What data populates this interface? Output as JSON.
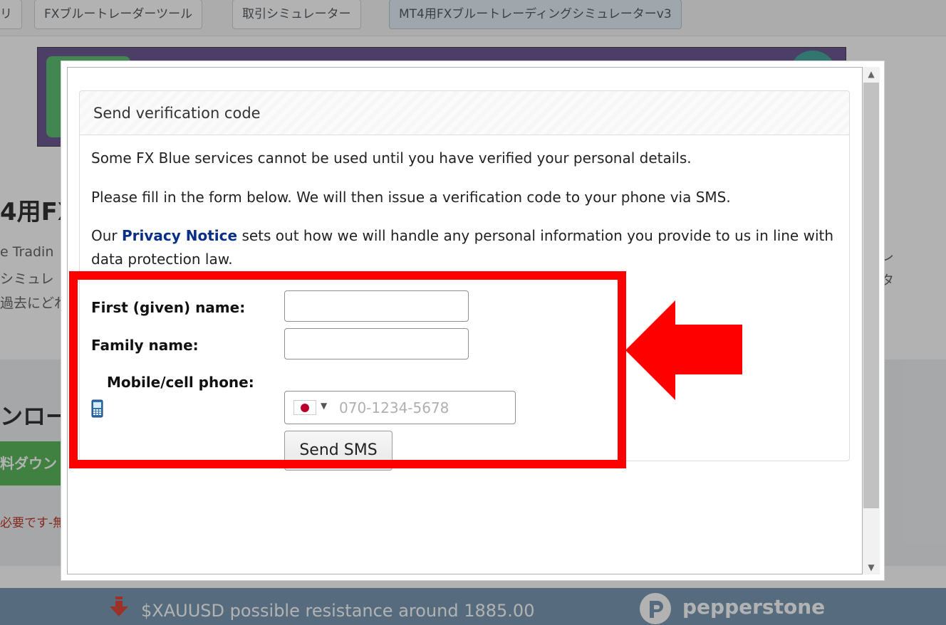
{
  "breadcrumbs": [
    {
      "label": "リ"
    },
    {
      "label": "FXブルートレーダーツール"
    },
    {
      "label": "取引シミュレーター"
    },
    {
      "label": "MT4用FXブルートレーディングシミュレーターv3"
    }
  ],
  "background": {
    "title_fragment": "4用FX",
    "lines": [
      "e Tradin",
      "シミュレ",
      "過去にどれ"
    ],
    "right_fragments": [
      "レ",
      "タ"
    ],
    "download_title_fragment": "ンロー",
    "download_button_fragment": "料ダウン",
    "note_fragment": "必要です-無"
  },
  "ticker": {
    "text": "$XAUUSD possible resistance around 1885.00",
    "icon": "down-arrow-icon",
    "brand": "pepperstone"
  },
  "modal": {
    "title": "Send verification code",
    "paragraphs": {
      "p1": "Some FX Blue services cannot be used until you have verified your personal details.",
      "p2": "Please fill in the form below. We will then issue a verification code to your phone via SMS.",
      "p3_prefix": "Our ",
      "p3_link": "Privacy Notice",
      "p3_suffix": " sets out how we will handle any personal information you provide to us in line with",
      "p3_line2": "data protection law."
    },
    "form": {
      "first_name_label": "First (given) name:",
      "first_name_value": "",
      "family_name_label": "Family name:",
      "family_name_value": "",
      "phone_label": "Mobile/cell phone:",
      "phone_icon": "mobile-phone-icon",
      "phone_placeholder": "070-1234-5678",
      "country_flag": "japan-flag-icon",
      "send_button": "Send SMS"
    }
  },
  "colors": {
    "annotation_red": "#ff0000",
    "link_blue": "#0a2f86",
    "ticker_bg": "#7b9bb5"
  }
}
